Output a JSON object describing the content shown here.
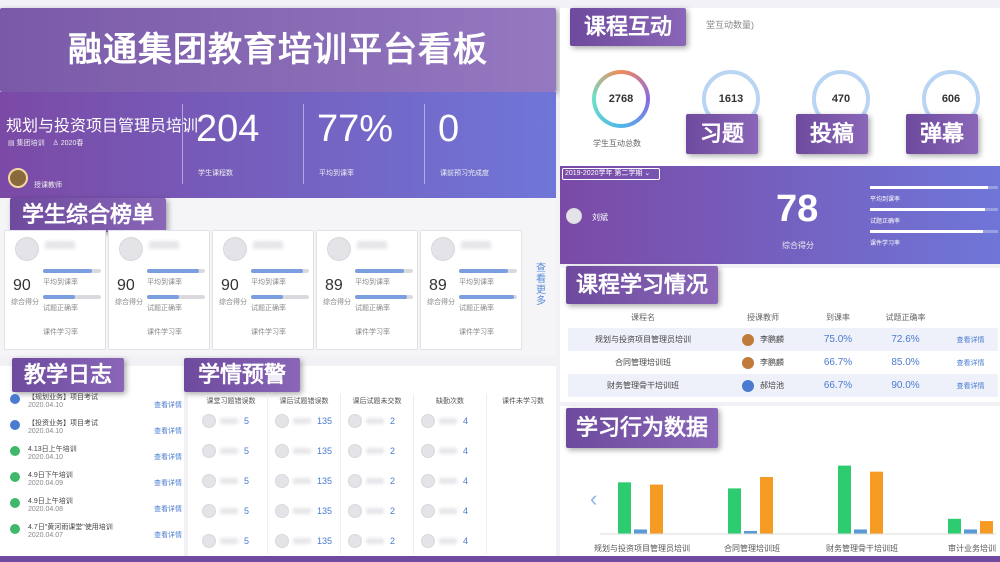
{
  "header": {
    "title": "融通集团教育培训平台看板"
  },
  "course": {
    "name": "规划与投资项目管理员培训",
    "group": "集团培训",
    "term": "2020春",
    "teacher_role": "授课教师",
    "stats": [
      {
        "value": "204",
        "label": "学生课程数"
      },
      {
        "value": "77%",
        "label": "平均到课率"
      },
      {
        "value": "0",
        "label": "课前预习完成度"
      }
    ]
  },
  "ranking": {
    "title": "学生综合榜单",
    "more": "查看更多",
    "labels": {
      "score": "综合得分",
      "attendance": "平均到课率",
      "quiz": "试题正确率",
      "courseware": "课件学习率"
    },
    "students": [
      {
        "score": "90",
        "attendance": 0.85,
        "quiz": 0.55,
        "courseware": 0.3
      },
      {
        "score": "90",
        "attendance": 0.9,
        "quiz": 0.55,
        "courseware": 0.3
      },
      {
        "score": "90",
        "attendance": 0.9,
        "quiz": 0.55,
        "courseware": 0.3
      },
      {
        "score": "89",
        "attendance": 0.85,
        "quiz": 0.9,
        "courseware": 0.5
      },
      {
        "score": "89",
        "attendance": 0.85,
        "quiz": 0.95,
        "courseware": 0.5
      }
    ]
  },
  "log": {
    "title": "教学日志",
    "view": "查看详情",
    "entries": [
      {
        "name": "【规划业务】项目考试",
        "date": "2020.04.10",
        "color": "#4a7bd0"
      },
      {
        "name": "【投资业务】项目考试",
        "date": "2020.04.10",
        "color": "#4a7bd0"
      },
      {
        "name": "4.13日上午培训",
        "date": "2020.04.10",
        "color": "#3fb86b"
      },
      {
        "name": "4.9日下午培训",
        "date": "2020.04.09",
        "color": "#3fb86b"
      },
      {
        "name": "4.9日上午培训",
        "date": "2020.04.08",
        "color": "#3fb86b"
      },
      {
        "name": "4.7日\"黄河雨课堂\"使用培训",
        "date": "2020.04.07",
        "color": "#3fb86b"
      }
    ]
  },
  "warning": {
    "title": "学情预警",
    "columns": [
      "课堂习题错误数",
      "课后试题错误数",
      "课后试题未交数",
      "缺勤次数",
      "课件未学习数"
    ],
    "rows": [
      [
        "5",
        "135",
        "2",
        "4"
      ],
      [
        "5",
        "135",
        "2",
        "4"
      ],
      [
        "5",
        "135",
        "2",
        "4"
      ],
      [
        "5",
        "135",
        "2",
        "4"
      ],
      [
        "5",
        "135",
        "2",
        "4"
      ]
    ]
  },
  "interaction": {
    "title": "课程互动",
    "subtitle": "堂互动数量)",
    "total": "2768",
    "total_label": "学生互动总数",
    "items": [
      {
        "value": "1613",
        "label": "习题"
      },
      {
        "value": "470",
        "label": "投稿"
      },
      {
        "value": "606",
        "label": "弹幕"
      }
    ]
  },
  "student_detail": {
    "semester": "2019-2020学年 第二学期",
    "name": "刘斌",
    "score": "78",
    "score_label": "综合得分",
    "metrics": [
      {
        "label": "平均到课率",
        "value": 0.92
      },
      {
        "label": "试题正确率",
        "value": 0.9
      },
      {
        "label": "课件学习率",
        "value": 0.88
      }
    ]
  },
  "course_study": {
    "title": "课程学习情况",
    "headers": [
      "课程名",
      "授课教师",
      "到课率",
      "试题正确率"
    ],
    "view": "查看详情",
    "rows": [
      {
        "course": "规划与投资项目管理员培训",
        "teacher": "李鹏麟",
        "attendance": "75.0%",
        "quiz": "72.6%"
      },
      {
        "course": "合同管理培训班",
        "teacher": "李鹏麟",
        "attendance": "66.7%",
        "quiz": "85.0%"
      },
      {
        "course": "财务管理骨干培训班",
        "teacher": "郝培池",
        "attendance": "66.7%",
        "quiz": "90.0%"
      }
    ]
  },
  "behavior": {
    "title": "学习行为数据",
    "chart_data": {
      "type": "bar",
      "categories": [
        "规划与投资项目管理员培训",
        "合同管理培训班",
        "财务管理骨干培训班",
        "审计业务培训"
      ],
      "series": [
        {
          "color": "#2ecc71",
          "values": [
            68,
            60,
            90,
            20
          ]
        },
        {
          "color": "#5b9bd5",
          "values": [
            6,
            4,
            6,
            6
          ]
        },
        {
          "color": "#f59a23",
          "values": [
            65,
            75,
            82,
            17
          ]
        }
      ],
      "ylim": [
        0,
        100
      ]
    }
  }
}
